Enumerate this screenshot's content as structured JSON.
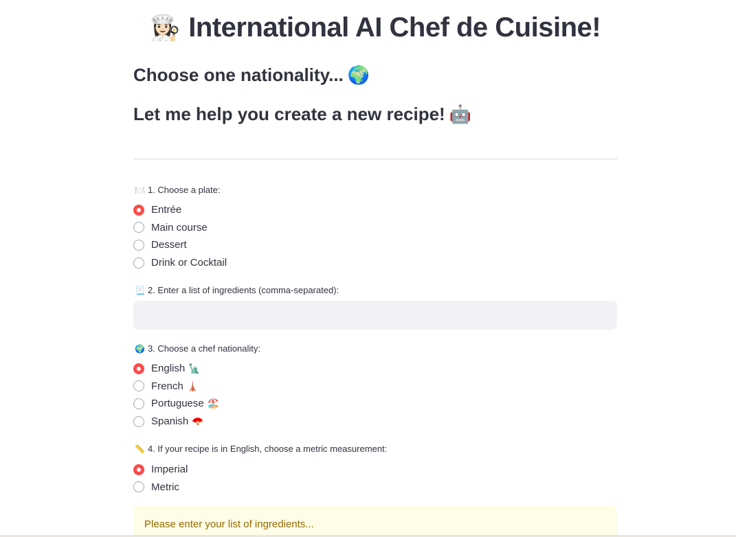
{
  "header": {
    "title_icon": "👩🏻‍🍳",
    "title": "International AI Chef de Cuisine!",
    "subtitle1": "Choose one nationality...",
    "subtitle1_icon": "🌍",
    "subtitle2": "Let me help you create a new recipe!",
    "subtitle2_icon": "🤖"
  },
  "plate": {
    "icon": "🍽️",
    "label": "1. Choose a plate:",
    "options": [
      {
        "label": "Entrée",
        "checked": true
      },
      {
        "label": "Main course",
        "checked": false
      },
      {
        "label": "Dessert",
        "checked": false
      },
      {
        "label": "Drink or Cocktail",
        "checked": false
      }
    ]
  },
  "ingredients": {
    "icon": "📃",
    "label": "2. Enter a list of ingredients (comma-separated):",
    "value": ""
  },
  "nationality": {
    "icon": "🌍",
    "label": "3. Choose a chef nationality:",
    "options": [
      {
        "label": "English",
        "icon": "🗽",
        "checked": true
      },
      {
        "label": "French",
        "icon": "🗼",
        "checked": false
      },
      {
        "label": "Portuguese",
        "icon": "🏖️",
        "checked": false
      },
      {
        "label": "Spanish",
        "icon": "🪭",
        "checked": false
      }
    ]
  },
  "measurement": {
    "icon": "📏",
    "label": "4. If your recipe is in English, choose a metric measurement:",
    "options": [
      {
        "label": "Imperial",
        "checked": true
      },
      {
        "label": "Metric",
        "checked": false
      }
    ]
  },
  "alert": {
    "text": "Please enter your list of ingredients..."
  },
  "colors": {
    "accent": "#ff4b4b",
    "text": "#31333f",
    "input_bg": "#f0f2f6",
    "warning_bg": "#fffce7",
    "warning_text": "#926c05"
  }
}
